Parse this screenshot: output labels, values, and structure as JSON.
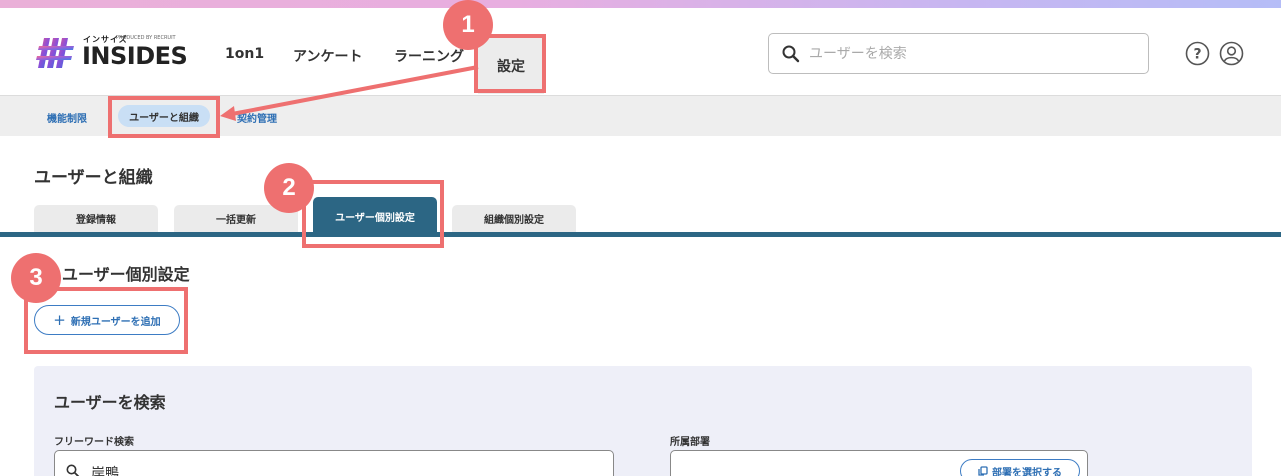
{
  "header": {
    "logo_kana": "インサイズ",
    "logo_produced_by": "PRODUCED BY RECRUIT",
    "logo_text": "INSIDES",
    "nav": [
      "1on1",
      "アンケート",
      "ラーニング",
      "設定"
    ],
    "search_placeholder": "ユーザーを検索"
  },
  "subnav": {
    "items": [
      "機能制限",
      "ユーザーと組織",
      "契約管理"
    ]
  },
  "page": {
    "title": "ユーザーと組織",
    "tabs": [
      "登録情報",
      "一括更新",
      "ユーザー個別設定",
      "組織個別設定"
    ],
    "section_title": "ユーザー個別設定",
    "add_button_label": "新規ユーザーを追加"
  },
  "search_panel": {
    "title": "ユーザーを検索",
    "keyword_label": "フリーワード検索",
    "keyword_value": "岸鴨",
    "department_label": "所属部署",
    "department_button_label": "部署を選択する"
  },
  "annotations": {
    "markers": [
      "1",
      "2",
      "3"
    ],
    "color": "#ee7070"
  },
  "colors": {
    "accent_blue": "#2e6fb4",
    "tab_active": "#2c6684",
    "subnav_pill": "#c9dff5"
  }
}
